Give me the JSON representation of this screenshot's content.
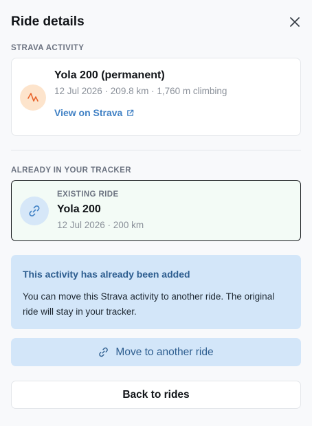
{
  "header": {
    "title": "Ride details",
    "close_icon": "close-icon"
  },
  "strava_section": {
    "label": "STRAVA ACTIVITY",
    "activity": {
      "name": "Yola 200 (permanent)",
      "meta": "12 Jul 2026 · 209.8 km · 1,760 m climbing",
      "link_label": "View on Strava",
      "icon": "strava-activity-icon",
      "link_icon": "external-link-icon"
    }
  },
  "tracker_section": {
    "label": "ALREADY IN YOUR TRACKER",
    "ride": {
      "label": "EXISTING RIDE",
      "name": "Yola 200",
      "meta": "12 Jul 2026 · 200 km",
      "icon": "link-icon"
    }
  },
  "notice": {
    "title": "This activity has already been added",
    "body": "You can move this Strava activity to another ride. The original ride will stay in your tracker."
  },
  "actions": {
    "move_label": "Move to another ride",
    "move_icon": "link-icon",
    "back_label": "Back to rides"
  },
  "colors": {
    "accent": "#3f80c4",
    "notice_bg": "#d3e6f9",
    "notice_text": "#2d5d8f",
    "strava_icon_bg": "#fde4cc",
    "strava_orange": "#e8632a",
    "existing_card_bg": "#f3fbf6"
  }
}
